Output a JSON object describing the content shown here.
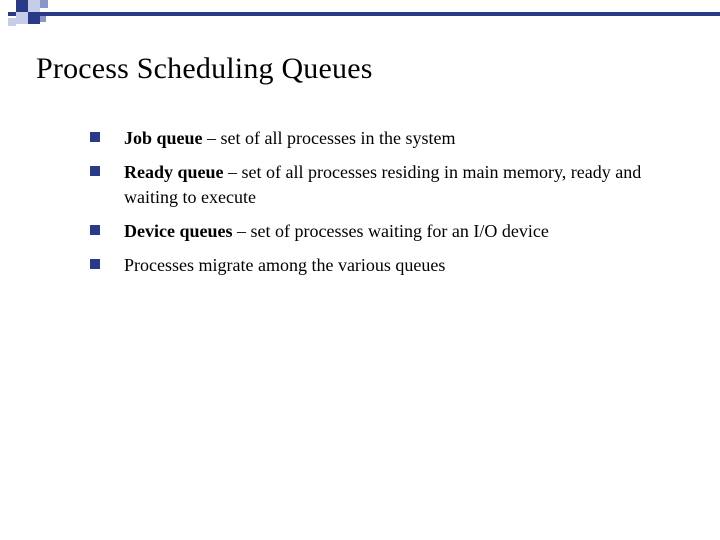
{
  "colors": {
    "accent": "#2b3a87",
    "accent_light": "#c6cde8",
    "accent_mid": "#8a97c9"
  },
  "slide": {
    "title": "Process Scheduling Queues",
    "bullets": [
      {
        "term": "Job queue",
        "rest": " – set of all processes in the system"
      },
      {
        "term": "Ready queue",
        "rest": " – set of all processes residing in main memory, ready and waiting to execute"
      },
      {
        "term": "Device queues",
        "rest": " – set of processes waiting for an I/O device"
      },
      {
        "term": "",
        "rest": "Processes migrate among the various queues"
      }
    ]
  }
}
